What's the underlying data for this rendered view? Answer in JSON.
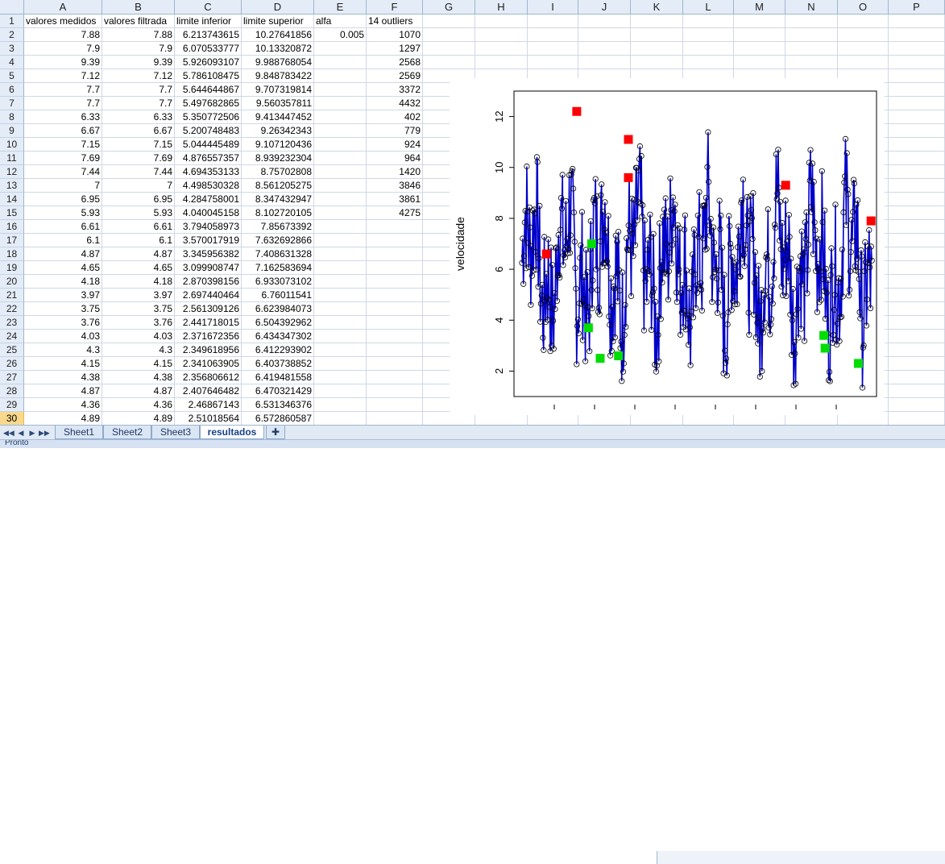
{
  "columns": [
    "A",
    "B",
    "C",
    "D",
    "E",
    "F",
    "G",
    "H",
    "I",
    "J",
    "K",
    "L",
    "M",
    "N",
    "O",
    "P"
  ],
  "rows": [
    [
      "valores medidos",
      "valores filtrada",
      "limite inferior",
      "limite superior",
      "alfa",
      "14  outliers"
    ],
    [
      "7.88",
      "7.88",
      "6.213743615",
      "10.27641856",
      "0.005",
      "1070"
    ],
    [
      "7.9",
      "7.9",
      "6.070533777",
      "10.13320872",
      "",
      "1297"
    ],
    [
      "9.39",
      "9.39",
      "5.926093107",
      "9.988768054",
      "",
      "2568"
    ],
    [
      "7.12",
      "7.12",
      "5.786108475",
      "9.848783422",
      "",
      "2569"
    ],
    [
      "7.7",
      "7.7",
      "5.644644867",
      "9.707319814",
      "",
      "3372"
    ],
    [
      "7.7",
      "7.7",
      "5.497682865",
      "9.560357811",
      "",
      "4432"
    ],
    [
      "6.33",
      "6.33",
      "5.350772506",
      "9.413447452",
      "",
      "402"
    ],
    [
      "6.67",
      "6.67",
      "5.200748483",
      "9.26342343",
      "",
      "779"
    ],
    [
      "7.15",
      "7.15",
      "5.044445489",
      "9.107120436",
      "",
      "924"
    ],
    [
      "7.69",
      "7.69",
      "4.876557357",
      "8.939232304",
      "",
      "964"
    ],
    [
      "7.44",
      "7.44",
      "4.694353133",
      "8.75702808",
      "",
      "1420"
    ],
    [
      "7",
      "7",
      "4.498530328",
      "8.561205275",
      "",
      "3846"
    ],
    [
      "6.95",
      "6.95",
      "4.284758001",
      "8.347432947",
      "",
      "3861"
    ],
    [
      "5.93",
      "5.93",
      "4.040045158",
      "8.102720105",
      "",
      "4275"
    ],
    [
      "6.61",
      "6.61",
      "3.794058973",
      "7.85673392",
      "",
      ""
    ],
    [
      "6.1",
      "6.1",
      "3.570017919",
      "7.632692866",
      "",
      ""
    ],
    [
      "4.87",
      "4.87",
      "3.345956382",
      "7.408631328",
      "",
      ""
    ],
    [
      "4.65",
      "4.65",
      "3.099908747",
      "7.162583694",
      "",
      ""
    ],
    [
      "4.18",
      "4.18",
      "2.870398156",
      "6.933073102",
      "",
      ""
    ],
    [
      "3.97",
      "3.97",
      "2.697440464",
      "6.76011541",
      "",
      ""
    ],
    [
      "3.75",
      "3.75",
      "2.561309126",
      "6.623984073",
      "",
      ""
    ],
    [
      "3.76",
      "3.76",
      "2.441718015",
      "6.504392962",
      "",
      ""
    ],
    [
      "4.03",
      "4.03",
      "2.371672356",
      "6.434347302",
      "",
      ""
    ],
    [
      "4.3",
      "4.3",
      "2.349618956",
      "6.412293902",
      "",
      ""
    ],
    [
      "4.15",
      "4.15",
      "2.341063905",
      "6.403738852",
      "",
      ""
    ],
    [
      "4.38",
      "4.38",
      "2.356806612",
      "6.419481558",
      "",
      ""
    ],
    [
      "4.87",
      "4.87",
      "2.407646482",
      "6.470321429",
      "",
      ""
    ],
    [
      "4.36",
      "4.36",
      "2.46867143",
      "6.531346376",
      "",
      ""
    ],
    [
      "4.89",
      "4.89",
      "2.51018564",
      "6.572860587",
      "",
      ""
    ]
  ],
  "sheet_tabs": [
    "Sheet1",
    "Sheet2",
    "Sheet3",
    "resultados"
  ],
  "active_tab": "resultados",
  "status": {
    "text": "Pronto"
  },
  "chart_data": {
    "type": "line",
    "ylabel": "velocidade",
    "xlabel": "",
    "ylim": [
      1,
      13
    ],
    "yticks": [
      2,
      4,
      6,
      8,
      10,
      12
    ],
    "line_color": "#0000cc",
    "red_points": [
      [
        402,
        6.6
      ],
      [
        779,
        12.2
      ],
      [
        1420,
        11.1
      ],
      [
        1420,
        9.6
      ],
      [
        3372,
        9.3
      ],
      [
        4432,
        7.9
      ]
    ],
    "green_points": [
      [
        924,
        3.7
      ],
      [
        1070,
        2.5
      ],
      [
        1297,
        2.6
      ],
      [
        964,
        7.0
      ],
      [
        3846,
        3.4
      ],
      [
        3861,
        2.9
      ],
      [
        4275,
        2.3
      ]
    ],
    "red_color": "#ff0000",
    "green_color": "#00dd00"
  }
}
